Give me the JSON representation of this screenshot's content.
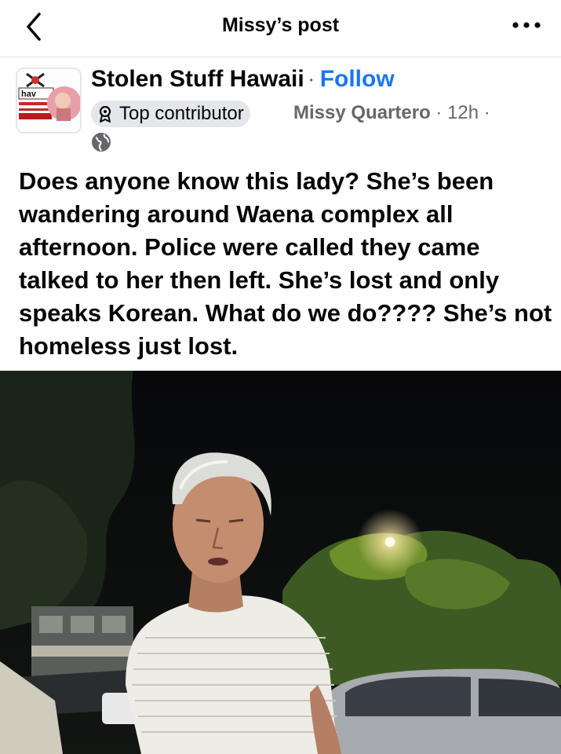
{
  "topbar": {
    "title": "Missy’s post"
  },
  "post": {
    "group_name": "Stolen Stuff Hawaii",
    "separator": "·",
    "follow_label": "Follow",
    "badge_label": "Top contributor",
    "author": "Missy Quartero",
    "timestamp": "12h",
    "meta_sep": "·",
    "avatar_text": "hav",
    "text": "Does anyone know this lady? She’s been wandering around Waena complex all afternoon.  Police were called they came talked to her then left. She’s lost and only speaks Korean.  What do we do???? She’s not homeless just lost."
  },
  "icons": {
    "back": "chevron-left-icon",
    "more": "more-horizontal-icon",
    "badge": "top-contributor-icon",
    "privacy": "globe-icon"
  },
  "colors": {
    "accent": "#1877f2",
    "secondary_text": "#65676b",
    "badge_bg": "#e4e6eb"
  }
}
